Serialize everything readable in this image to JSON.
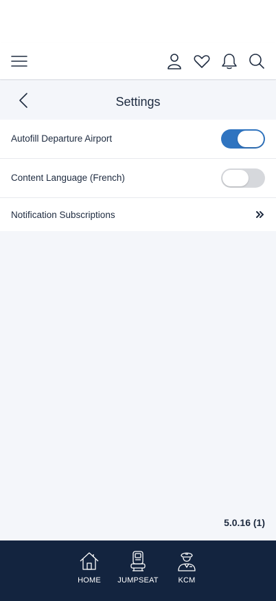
{
  "header": {
    "icons": [
      "menu-icon",
      "profile-icon",
      "heart-icon",
      "bell-icon",
      "search-icon"
    ]
  },
  "titlebar": {
    "title": "Settings",
    "back_icon": "chevron-left-icon"
  },
  "settings": {
    "items": [
      {
        "label": "Autofill Departure Airport",
        "control": "toggle",
        "on": true
      },
      {
        "label": "Content Language (French)",
        "control": "toggle",
        "on": false
      },
      {
        "label": "Notification Subscriptions",
        "control": "chevron-double-right-icon"
      }
    ]
  },
  "version": "5.0.16 (1)",
  "colors": {
    "accent": "#2f74c0",
    "tabbar": "#13243f",
    "toggle_off": "#d6d8dc",
    "background": "#f4f6fa"
  },
  "tabbar": {
    "tabs": [
      {
        "label": "HOME",
        "icon": "home-icon"
      },
      {
        "label": "JUMPSEAT",
        "icon": "seat-icon"
      },
      {
        "label": "KCM",
        "icon": "pilot-icon"
      }
    ]
  }
}
